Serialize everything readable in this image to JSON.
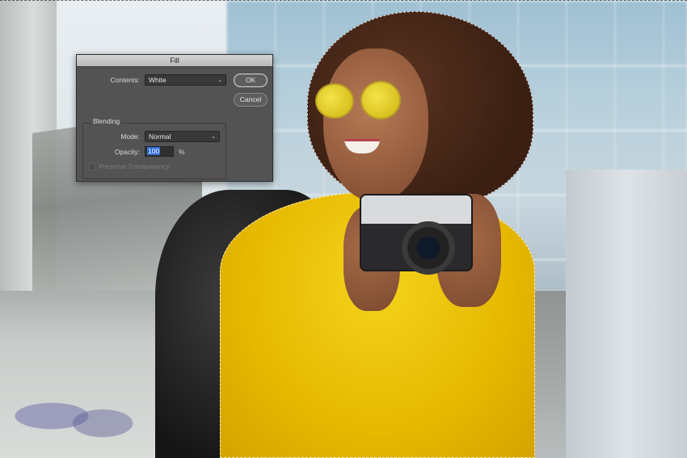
{
  "dialog": {
    "title": "Fill",
    "contents_label": "Contents:",
    "contents_value": "White",
    "ok_label": "OK",
    "cancel_label": "Cancel",
    "blending": {
      "group_title": "Blending",
      "mode_label": "Mode:",
      "mode_value": "Normal",
      "opacity_label": "Opacity:",
      "opacity_value": "100",
      "opacity_unit": "%",
      "preserve_label": "Preserve Transparency",
      "preserve_checked": false,
      "preserve_enabled": false
    }
  },
  "icons": {
    "dropdown": "chevron-down-icon"
  },
  "colors": {
    "dialog_bg": "#535353",
    "selection_highlight": "#2f6bd8",
    "sweater": "#f4d31c"
  }
}
